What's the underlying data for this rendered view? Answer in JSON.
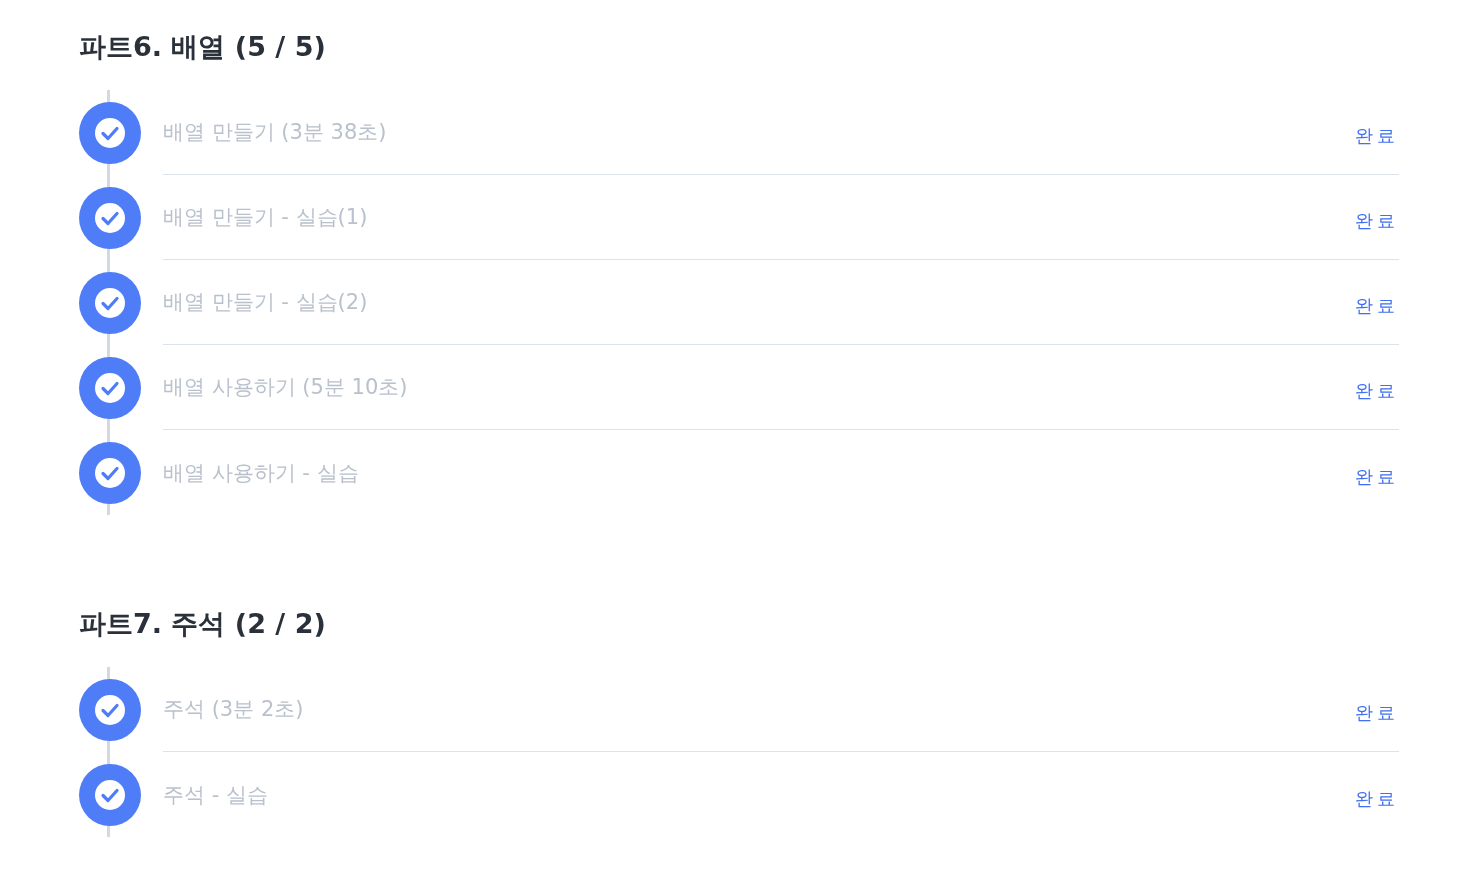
{
  "sections": [
    {
      "title": "파트6. 배열 (5 / 5)",
      "lessons": [
        {
          "title": "배열 만들기 (3분 38초)",
          "completed": true,
          "status": "완료"
        },
        {
          "title": "배열 만들기 - 실습(1)",
          "completed": true,
          "status": "완료"
        },
        {
          "title": "배열 만들기 - 실습(2)",
          "completed": true,
          "status": "완료"
        },
        {
          "title": "배열 사용하기 (5분 10초)",
          "completed": true,
          "status": "완료"
        },
        {
          "title": "배열 사용하기 - 실습",
          "completed": true,
          "status": "완료"
        }
      ]
    },
    {
      "title": "파트7. 주석 (2 / 2)",
      "lessons": [
        {
          "title": "주석 (3분 2초)",
          "completed": true,
          "status": "완료"
        },
        {
          "title": "주석 - 실습",
          "completed": true,
          "status": "완료"
        }
      ]
    }
  ]
}
